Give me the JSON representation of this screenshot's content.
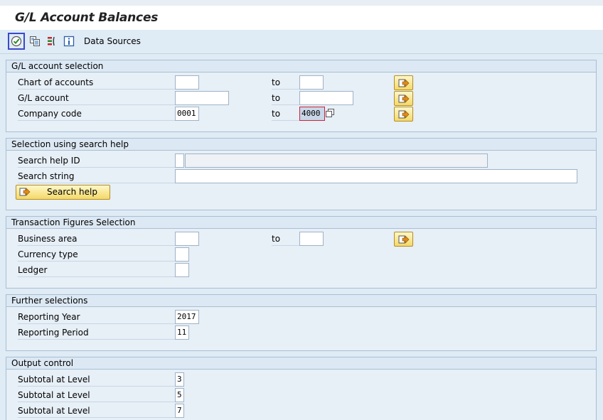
{
  "window": {
    "title": "G/L Account Balances"
  },
  "toolbar": {
    "execute_icon": "execute-clock-check-icon",
    "variant_icon": "get-variant-icon",
    "multi_select_icon": "dynamic-selections-icon",
    "info_icon": "info-icon",
    "data_sources_label": "Data Sources"
  },
  "groups": {
    "gl_account_selection": {
      "title": "G/L account selection",
      "rows": [
        {
          "label": "Chart of accounts",
          "from": "",
          "to_label": "to",
          "to": ""
        },
        {
          "label": "G/L account",
          "from": "",
          "to_label": "to",
          "to": ""
        },
        {
          "label": "Company code",
          "from": "0001",
          "to_label": "to",
          "to": "4000"
        }
      ]
    },
    "search_help": {
      "title": "Selection using search help",
      "search_help_id_label": "Search help ID",
      "search_help_id_value": "",
      "search_help_desc": "",
      "search_string_label": "Search string",
      "search_string_value": "",
      "search_button_label": "Search help"
    },
    "transaction_figures": {
      "title": "Transaction Figures Selection",
      "business_area_label": "Business area",
      "business_area_from": "",
      "to_label": "to",
      "business_area_to": "",
      "currency_type_label": "Currency type",
      "currency_type_value": "",
      "ledger_label": "Ledger",
      "ledger_value": ""
    },
    "further": {
      "title": "Further selections",
      "reporting_year_label": "Reporting Year",
      "reporting_year_value": "2017",
      "reporting_period_label": "Reporting Period",
      "reporting_period_value": "11"
    },
    "output": {
      "title": "Output control",
      "rows": [
        {
          "label": "Subtotal at Level",
          "value": "3"
        },
        {
          "label": "Subtotal at Level",
          "value": "5"
        },
        {
          "label": "Subtotal at Level",
          "value": "7"
        }
      ]
    }
  },
  "colors": {
    "accent": "#3b48c9",
    "button_yellow": "#f4d969",
    "background": "#dfebf5"
  }
}
